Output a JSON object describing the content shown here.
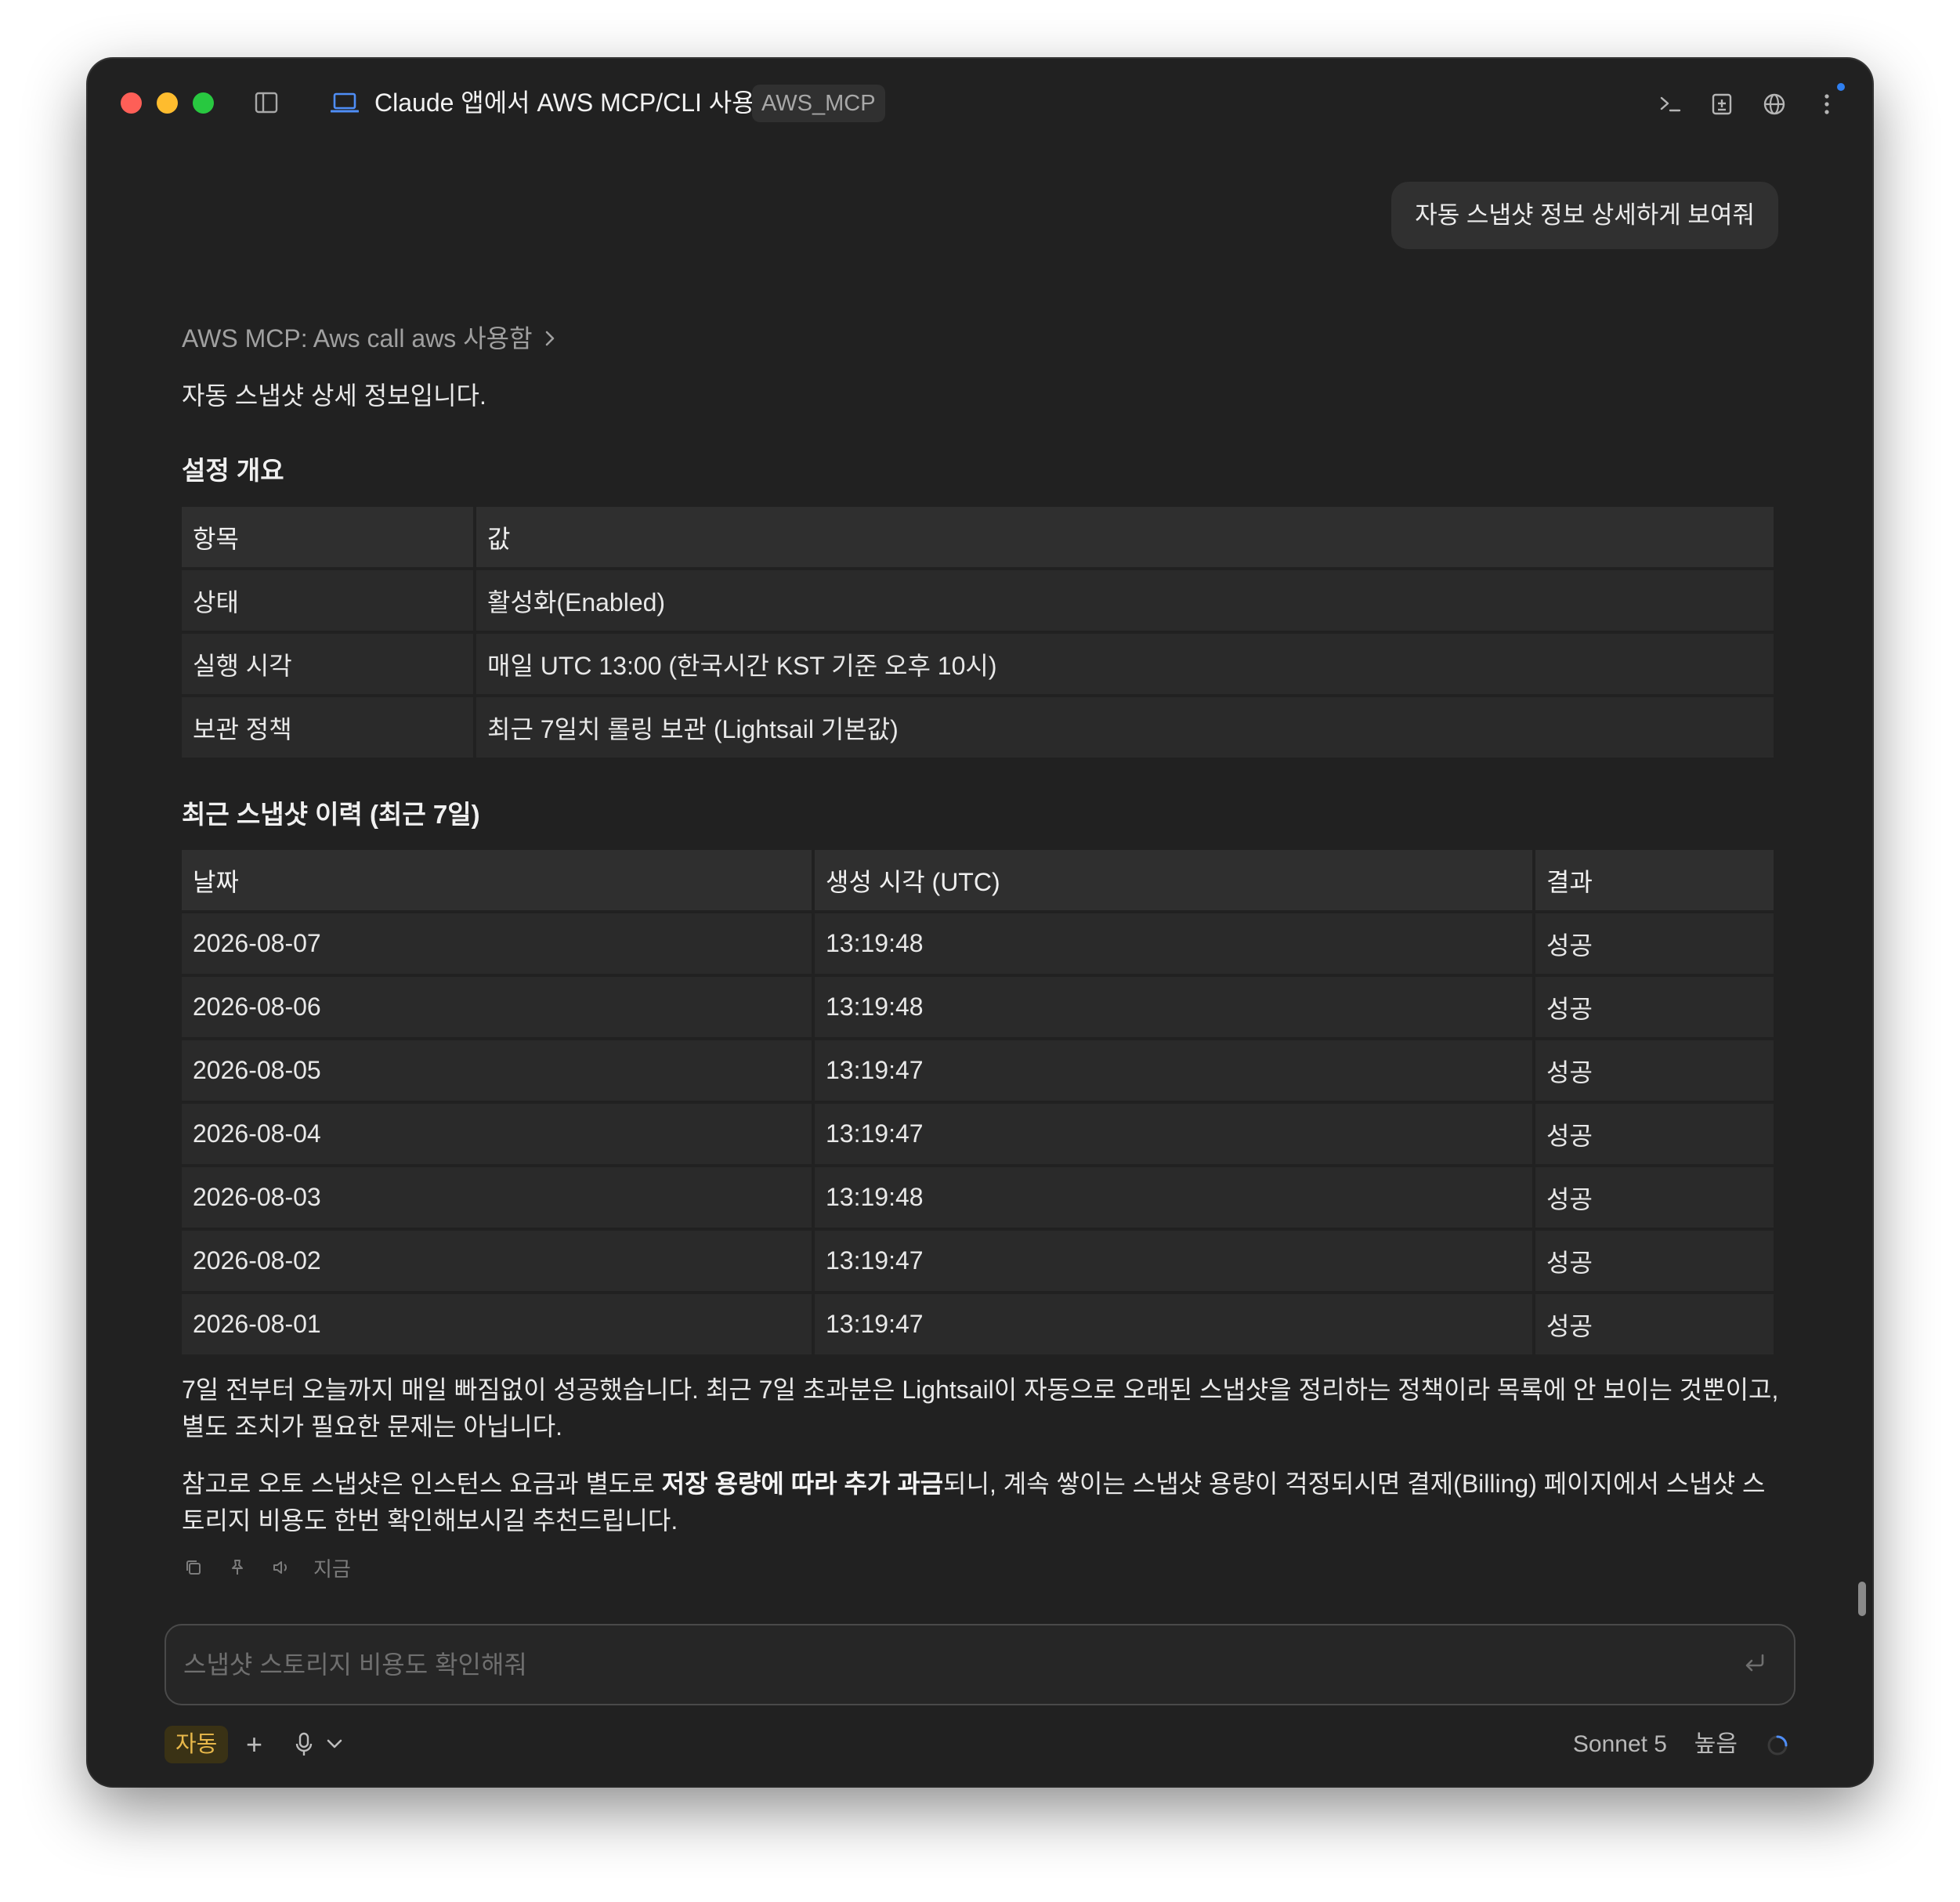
{
  "window": {
    "title": "Claude 앱에서 AWS MCP/CLI 사용",
    "project_tag": "AWS_MCP",
    "icons": [
      "sidebar-icon",
      "laptop-icon",
      "terminal-icon",
      "add-panel-icon",
      "globe-icon",
      "more-icon"
    ],
    "accent_dot_color": "#2f7ff0"
  },
  "user_message": "자동 스냅샷 정보 상세하게 보여줘",
  "assistant": {
    "tool_call": "AWS MCP: Aws call aws 사용함",
    "intro": "자동 스냅샷 상세 정보입니다.",
    "section1_title": "설정 개요",
    "settings_table": {
      "headers": [
        "항목",
        "값"
      ],
      "rows": [
        [
          "상태",
          "활성화(Enabled)"
        ],
        [
          "실행 시각",
          "매일 UTC 13:00 (한국시간 KST 기준 오후 10시)"
        ],
        [
          "보관 정책",
          "최근 7일치 롤링 보관 (Lightsail 기본값)"
        ]
      ]
    },
    "section2_title": "최근 스냅샷 이력 (최근 7일)",
    "history_table": {
      "headers": [
        "날짜",
        "생성 시각 (UTC)",
        "결과"
      ],
      "rows": [
        [
          "2026-08-07",
          "13:19:48",
          "성공"
        ],
        [
          "2026-08-06",
          "13:19:48",
          "성공"
        ],
        [
          "2026-08-05",
          "13:19:47",
          "성공"
        ],
        [
          "2026-08-04",
          "13:19:47",
          "성공"
        ],
        [
          "2026-08-03",
          "13:19:48",
          "성공"
        ],
        [
          "2026-08-02",
          "13:19:47",
          "성공"
        ],
        [
          "2026-08-01",
          "13:19:47",
          "성공"
        ]
      ]
    },
    "paragraph1": "7일 전부터 오늘까지 매일 빠짐없이 성공했습니다. 최근 7일 초과분은 Lightsail이 자동으로 오래된 스냅샷을 정리하는 정책이라 목록에 안 보이는 것뿐이고, 별도 조치가 필요한 문제는 아닙니다.",
    "paragraph2_before": "참고로 오토 스냅샷은 인스턴스 요금과 별도로 ",
    "paragraph2_bold": "저장 용량에 따라 추가 과금",
    "paragraph2_after": "되니, 계속 쌓이는 스냅샷 용량이 걱정되시면 결제(Billing) 페이지에서 스냅샷 스토리지 비용도 한번 확인해보시길 추천드립니다.",
    "timestamp": "지금"
  },
  "composer": {
    "placeholder": "스냅샷 스토리지 비용도 확인해줘",
    "mode_badge": "자동",
    "model": "Sonnet 5",
    "effort": "높음"
  }
}
